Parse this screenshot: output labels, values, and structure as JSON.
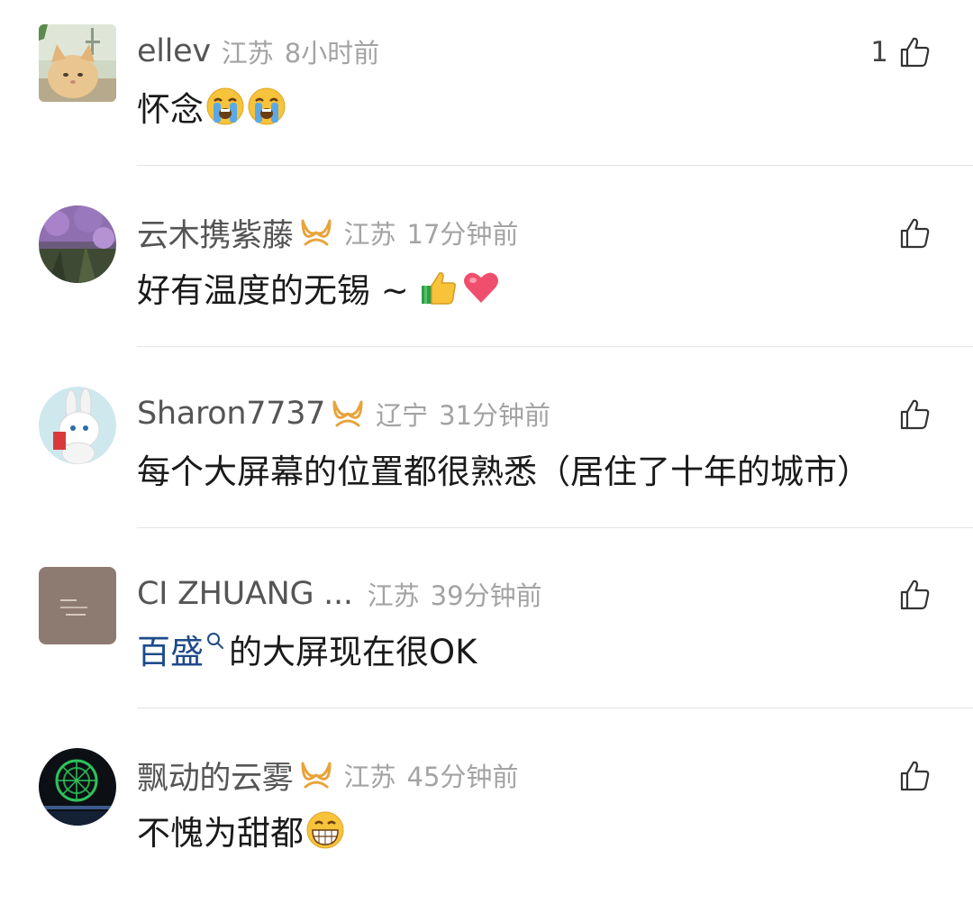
{
  "comments": [
    {
      "username": "ellev",
      "location": "江苏",
      "time": "8小时前",
      "text": "怀念",
      "like_count": "1",
      "avatar": "cat-photo-avatar",
      "emojis": [
        "crying-face-emoji",
        "crying-face-emoji"
      ]
    },
    {
      "username": "云木携紫藤",
      "location": "江苏",
      "time": "17分钟前",
      "text": "好有温度的无锡 ~",
      "like_count": "",
      "avatar": "wisteria-photo-avatar",
      "emojis": [
        "thumbs-up-emoji",
        "heart-emoji"
      ]
    },
    {
      "username": "Sharon7737",
      "location": "辽宁",
      "time": "31分钟前",
      "text": "每个大屏幕的位置都很熟悉（居住了十年的城市）",
      "like_count": "",
      "avatar": "bunny-avatar",
      "emojis": []
    },
    {
      "username": "CI ZHUANG ...",
      "location": "江苏",
      "time": "39分钟前",
      "link_text": "百盛",
      "text": "的大屏现在很OK",
      "like_count": "",
      "avatar": "text-card-avatar",
      "emojis": []
    },
    {
      "username": "飘动的云雾",
      "location": "江苏",
      "time": "45分钟前",
      "text": "不愧为甜都",
      "like_count": "",
      "avatar": "ferris-wheel-night-avatar",
      "emojis": [
        "grinning-face-emoji"
      ]
    }
  ],
  "colors": {
    "username": "#555555",
    "meta": "#a3a3a3",
    "badge": "#e8a33a",
    "link": "#1e4a8a",
    "divider": "#e4e4e4"
  }
}
